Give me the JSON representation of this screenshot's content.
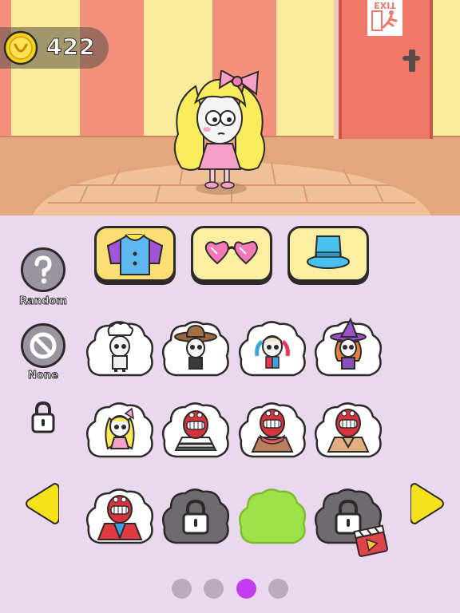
{
  "coins": {
    "value": "422",
    "icon": "coin-icon"
  },
  "scene": {
    "exit_sign": "EXIT"
  },
  "categories": [
    {
      "name": "shirt",
      "icon": "shirt-icon",
      "selected": true
    },
    {
      "name": "glasses",
      "icon": "heart-glasses-icon",
      "selected": false
    },
    {
      "name": "hat",
      "icon": "top-hat-icon",
      "selected": false
    }
  ],
  "side": {
    "random_label": "Random",
    "none_label": "None"
  },
  "outfits": [
    {
      "name": "chef",
      "state": "unlocked"
    },
    {
      "name": "cowboy",
      "state": "unlocked"
    },
    {
      "name": "harley",
      "state": "unlocked"
    },
    {
      "name": "witch",
      "state": "unlocked"
    },
    {
      "name": "blonde-girl",
      "state": "unlocked"
    },
    {
      "name": "prisoner",
      "state": "unlocked"
    },
    {
      "name": "scarf-coat",
      "state": "unlocked"
    },
    {
      "name": "trench-coat",
      "state": "unlocked"
    },
    {
      "name": "jester-suit",
      "state": "unlocked"
    },
    {
      "name": "locked",
      "state": "locked"
    },
    {
      "name": "green",
      "state": "selected"
    },
    {
      "name": "locked-video",
      "state": "locked-ad"
    }
  ],
  "pagination": {
    "pages": 4,
    "active": 3
  },
  "colors": {
    "panel": "#ead9ee",
    "cloud": "#ffffff",
    "locked": "#6e6a6f",
    "selected": "#9ee24a",
    "active_dot": "#c43cf2",
    "arrow": "#f6e21a"
  }
}
